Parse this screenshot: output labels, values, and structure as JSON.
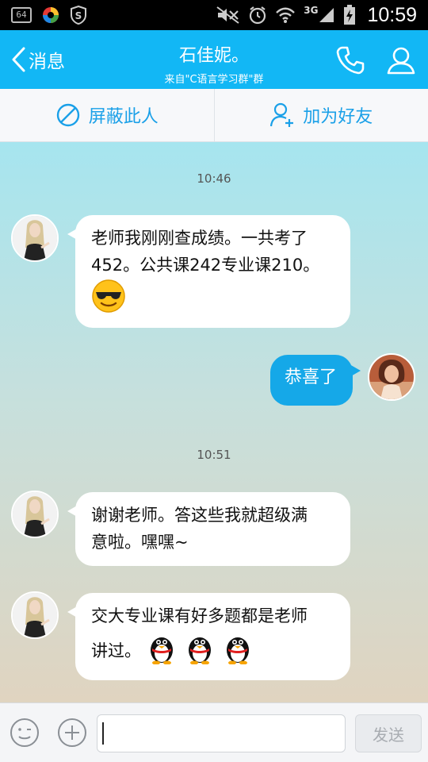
{
  "status_bar": {
    "badge": "64",
    "network": "3G",
    "time": "10:59",
    "icons": [
      "64-badge",
      "app-ring-icon",
      "shield-s-icon",
      "mute-icon",
      "alarm-icon",
      "wifi-icon",
      "signal-icon",
      "battery-charging-icon"
    ]
  },
  "header": {
    "back_label": "消息",
    "title": "石佳妮。",
    "subtitle": "来自\"C语言学习群\"群",
    "accent": "#12b7f5"
  },
  "actions": {
    "block_label": "屏蔽此人",
    "add_friend_label": "加为好友"
  },
  "messages": [
    {
      "type": "time",
      "text": "10:46"
    },
    {
      "type": "left",
      "text": "老师我刚刚查成绩。一共考了452。公共课242专业课210。",
      "emoji": "sunglasses-smiley"
    },
    {
      "type": "right",
      "text": "恭喜了"
    },
    {
      "type": "time",
      "text": "10:51"
    },
    {
      "type": "left",
      "text": "谢谢老师。答这些我就超级满意啦。嘿嘿~"
    },
    {
      "type": "left",
      "text": "交大专业课有好多题都是老师讲过。",
      "emoji": "penguin x3"
    }
  ],
  "msg": {
    "t1": "10:46",
    "m1_line1": "老师我刚刚查成绩。一共考了",
    "m1_line2": "452。公共课242专业课210。",
    "m2": "恭喜了",
    "t2": "10:51",
    "m3_line1": "谢谢老师。答这些我就超级满",
    "m3_line2": "意啦。嘿嘿~",
    "m4_line1": "交大专业课有好多题都是老师",
    "m4_line2": "讲过。"
  },
  "input": {
    "value": "",
    "send_label": "发送"
  }
}
